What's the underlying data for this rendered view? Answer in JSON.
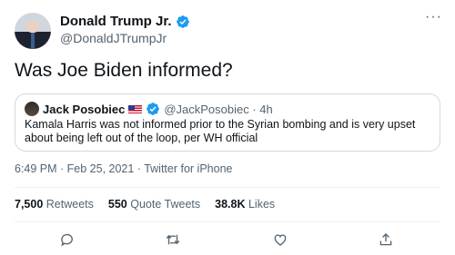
{
  "tweet": {
    "author": {
      "display_name": "Donald Trump Jr.",
      "handle": "@DonaldJTrumpJr",
      "verified": true
    },
    "text": "Was Joe Biden informed?",
    "more_icon": "more-icon",
    "quote": {
      "author_name": "Jack Posobiec",
      "flag": "🇺🇸",
      "handle_time": "@JackPosobiec · 4h",
      "text": "Kamala Harris was not informed prior to the Syrian bombing and is very upset about being left out of the loop, per WH official"
    },
    "meta": "6:49 PM · Feb 25, 2021 · Twitter for iPhone",
    "stats": {
      "retweets_count": "7,500",
      "retweets_label": "Retweets",
      "quotes_count": "550",
      "quotes_label": "Quote Tweets",
      "likes_count": "38.8K",
      "likes_label": "Likes"
    },
    "actions": [
      "reply-icon",
      "retweet-icon",
      "like-icon",
      "share-icon"
    ]
  },
  "colors": {
    "text": "#0f1419",
    "secondary": "#536471",
    "verified": "#1d9bf0",
    "border": "#cfd9de"
  }
}
